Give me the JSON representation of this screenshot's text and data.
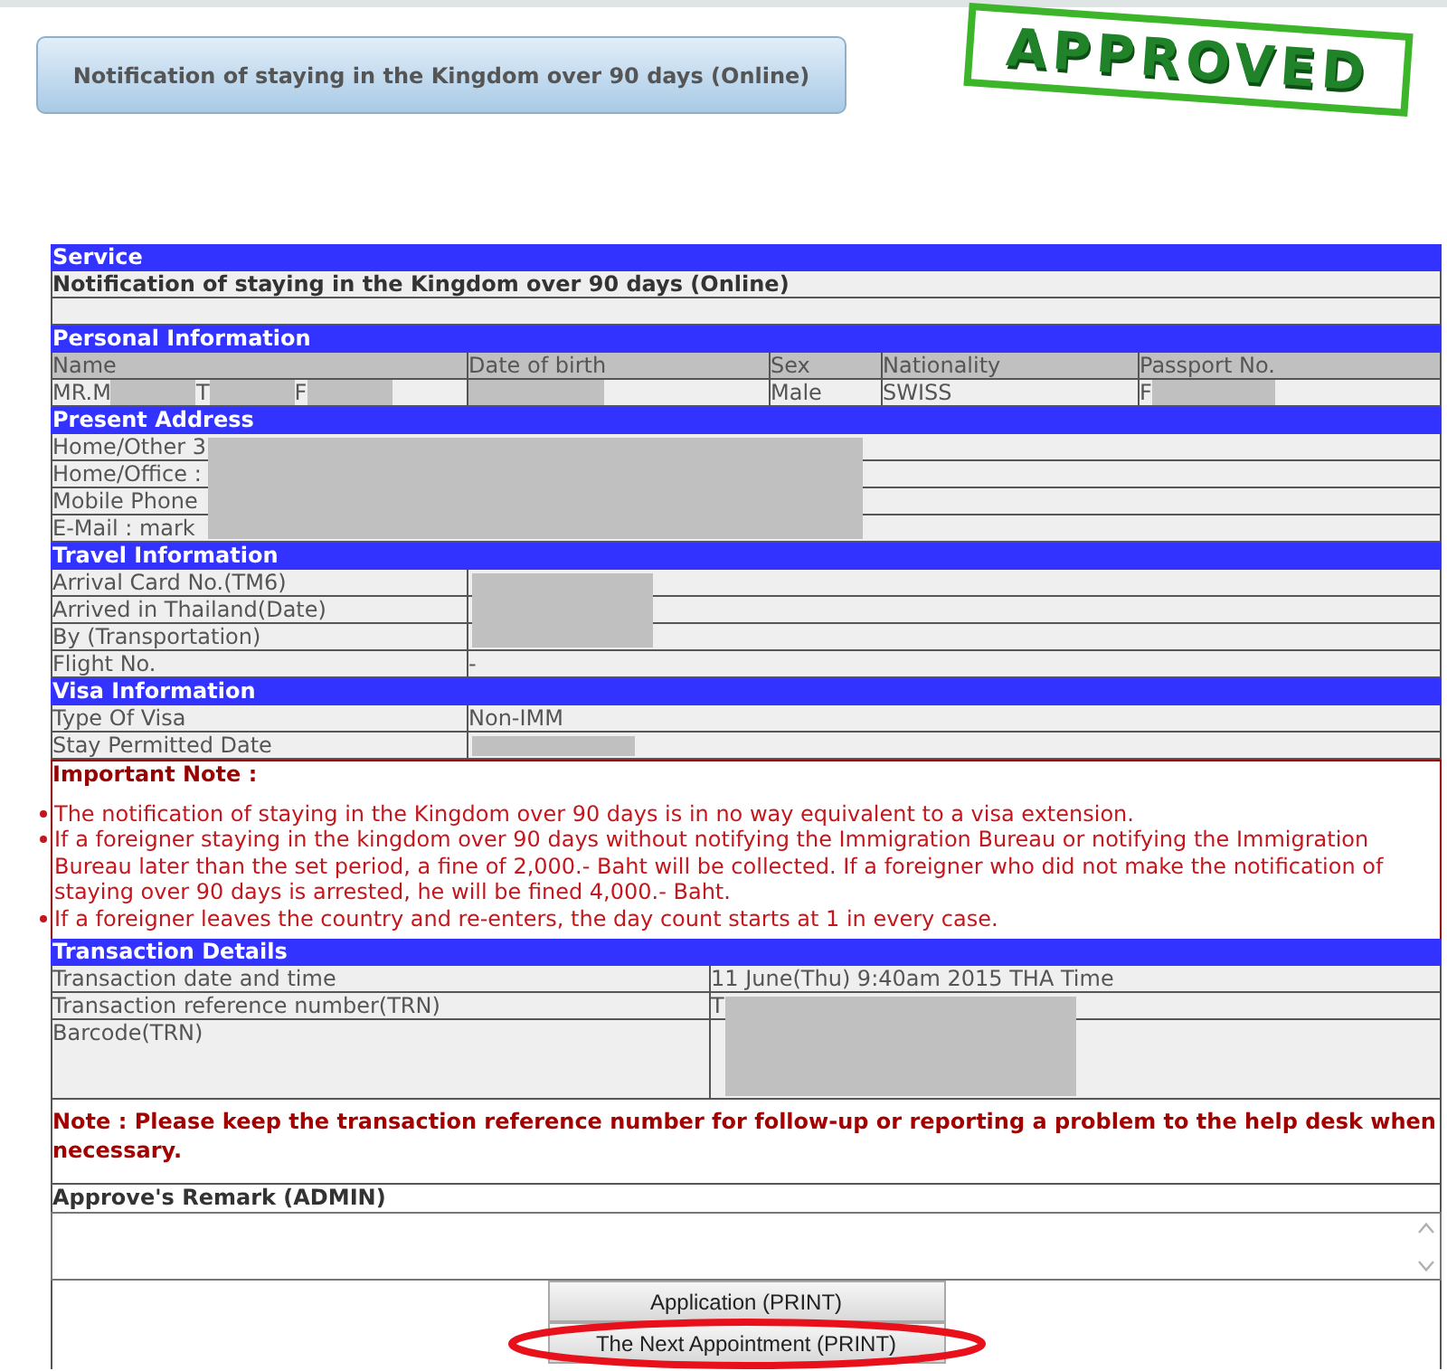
{
  "header_button": {
    "label": "Notification of staying in the Kingdom over 90 days (Online)"
  },
  "stamp": {
    "text": "APPROVED"
  },
  "service": {
    "heading": "Service",
    "value": "Notification of staying in the Kingdom over 90 days (Online)"
  },
  "personal_information": {
    "heading": "Personal Information",
    "columns": [
      "Name",
      "Date of birth",
      "Sex",
      "Nationality",
      "Passport No."
    ],
    "values": [
      [
        {
          "kind": "text",
          "text": "MR.M"
        },
        {
          "kind": "redacted"
        },
        {
          "kind": "text",
          "text": "T"
        },
        {
          "kind": "redacted"
        },
        {
          "kind": "text",
          "text": "F"
        },
        {
          "kind": "redacted"
        }
      ],
      [
        {
          "kind": "redacted"
        }
      ],
      [
        {
          "kind": "text",
          "text": "Male"
        }
      ],
      [
        {
          "kind": "text",
          "text": "SWISS"
        }
      ],
      [
        {
          "kind": "text",
          "text": "F"
        },
        {
          "kind": "redacted"
        }
      ]
    ]
  },
  "present_address": {
    "heading": "Present Address",
    "rows": [
      {
        "text": "Home/Other 3",
        "redacted": true
      },
      {
        "text": "Home/Office :",
        "redacted": true
      },
      {
        "text": "Mobile Phone",
        "redacted": true
      },
      {
        "text": "E-Mail : mark",
        "redacted": true
      }
    ]
  },
  "travel_information": {
    "heading": "Travel Information",
    "rows": [
      {
        "label": "Arrival Card No.(TM6)",
        "redacted": true
      },
      {
        "label": "Arrived in Thailand(Date)",
        "redacted": true
      },
      {
        "label": "By (Transportation)",
        "redacted": true
      },
      {
        "label": "Flight No.",
        "value": "-",
        "redacted": false
      }
    ]
  },
  "visa_information": {
    "heading": "Visa Information",
    "rows": [
      {
        "label": "Type Of Visa",
        "value": "Non-IMM",
        "redacted": false
      },
      {
        "label": "Stay Permitted Date",
        "redacted": true
      }
    ]
  },
  "important_note": {
    "title": "Important Note :",
    "items": [
      "The notification of staying in the Kingdom over 90 days is in no way equivalent to a visa extension.",
      "If a foreigner staying in the kingdom over 90 days without notifying the Immigration Bureau or notifying the Immigration Bureau later than the set period, a fine of 2,000.- Baht will be collected. If a foreigner who did not make the notification of staying over 90 days is arrested, he will be fined 4,000.- Baht.",
      "If a foreigner leaves the country and re-enters, the day count starts at 1 in every case."
    ]
  },
  "transaction_details": {
    "heading": "Transaction Details",
    "rows": [
      {
        "kind": "line",
        "label": "Transaction date and time",
        "value": "11 June(Thu) 9:40am 2015 THA Time",
        "redacted": false
      },
      {
        "kind": "line",
        "label": "Transaction reference number(TRN)",
        "value": "T",
        "redacted": true
      },
      {
        "kind": "barcode",
        "label": "Barcode(TRN)",
        "redacted": true
      }
    ]
  },
  "note": {
    "text": "Note : Please keep the transaction reference number for follow-up or reporting a problem to the help desk when necessary."
  },
  "remark": {
    "label": "Approve's Remark (ADMIN)"
  },
  "print_buttons": [
    {
      "label": "Application (PRINT)",
      "highlighted": false
    },
    {
      "label": "The Next Appointment (PRINT)",
      "highlighted": true
    }
  ]
}
